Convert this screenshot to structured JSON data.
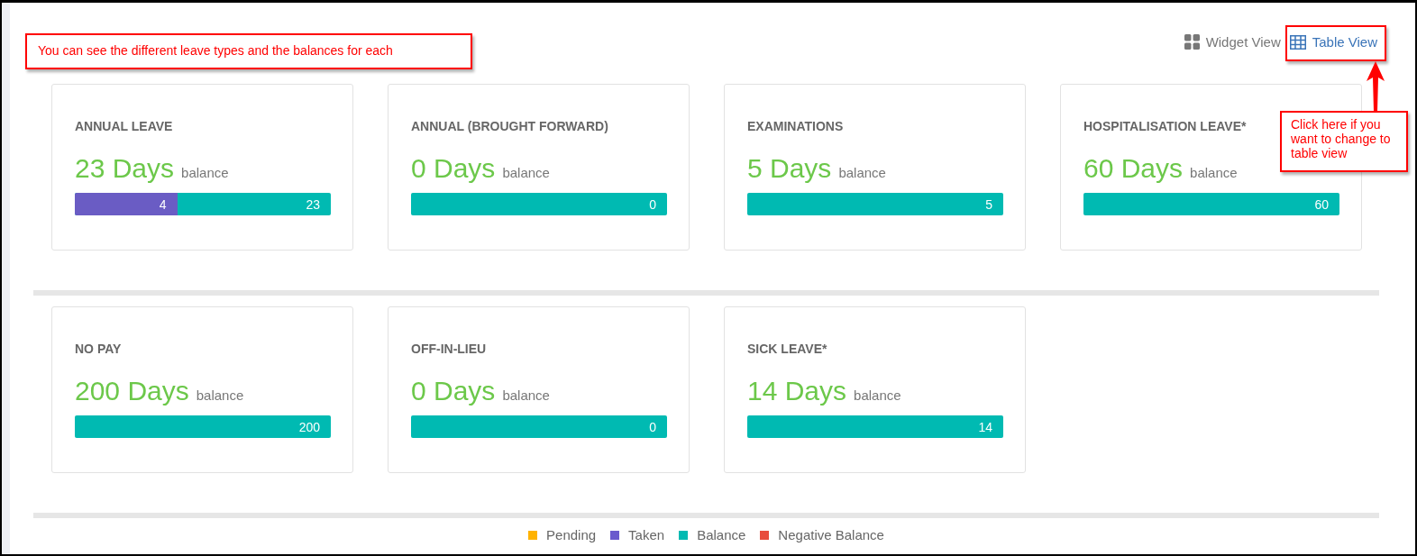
{
  "annotations": [
    {
      "kind": "note",
      "text": "You can see the different leave types and the balances for each"
    },
    {
      "kind": "callout",
      "text": "Click here if you want to change to table view"
    }
  ],
  "view_toggle": [
    {
      "kind": "widget",
      "label": "Widget View",
      "selected": true
    },
    {
      "kind": "table",
      "label": "Table View",
      "selected": false
    }
  ],
  "card_rows": [
    [
      {
        "title": "ANNUAL LEAVE",
        "amount": "23 Days",
        "unit": "balance",
        "balance": "23",
        "taken": {
          "label": "4",
          "level": 0.4
        }
      },
      {
        "title": "ANNUAL (BROUGHT FORWARD)",
        "amount": "0 Days",
        "unit": "balance",
        "balance": "0"
      },
      {
        "title": "EXAMINATIONS",
        "amount": "5 Days",
        "unit": "balance",
        "balance": "5"
      },
      {
        "title": "HOSPITALISATION LEAVE*",
        "amount": "60 Days",
        "unit": "balance",
        "balance": "60"
      }
    ],
    [
      {
        "title": "NO PAY",
        "amount": "200 Days",
        "unit": "balance",
        "balance": "200"
      },
      {
        "title": "OFF-IN-LIEU",
        "amount": "0 Days",
        "unit": "balance",
        "balance": "0"
      },
      {
        "title": "SICK LEAVE*",
        "amount": "14 Days",
        "unit": "balance",
        "balance": "14"
      }
    ]
  ],
  "legend": [
    {
      "label": "Pending",
      "color": "#ffb300"
    },
    {
      "label": "Taken",
      "color": "#6a5acd"
    },
    {
      "label": "Balance",
      "color": "#00bab2"
    },
    {
      "label": "Negative Balance",
      "color": "#e84c3d"
    }
  ]
}
